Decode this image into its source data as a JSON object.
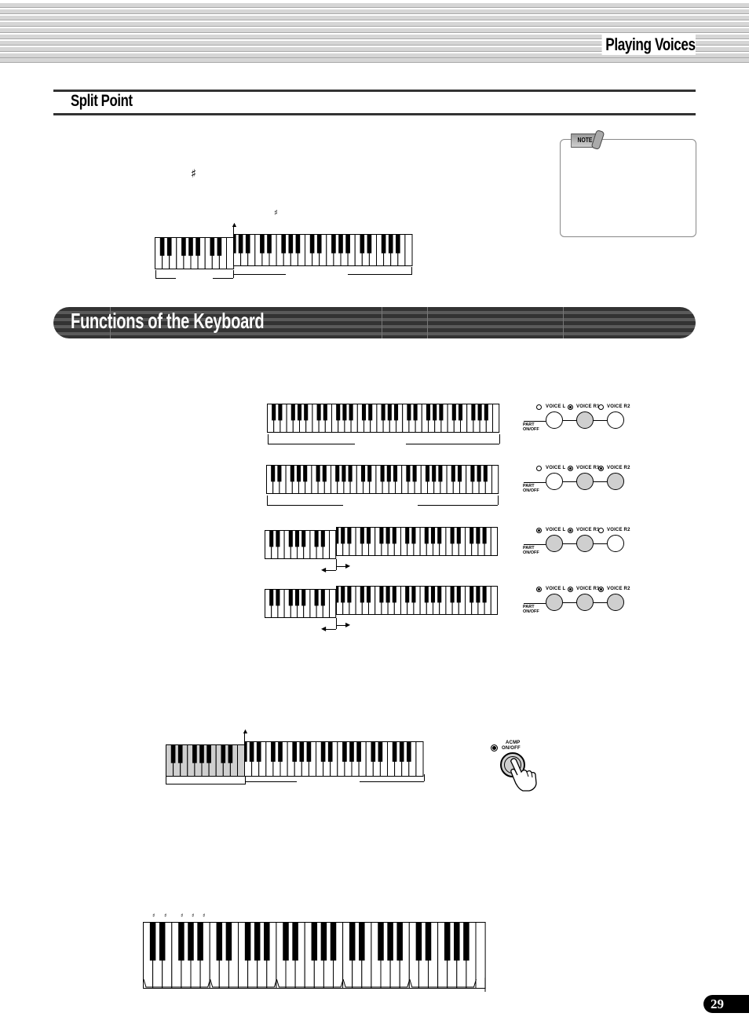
{
  "header": {
    "running_head": "Playing Voices"
  },
  "split_point": {
    "title": "Split Point",
    "sharp_symbol_1": "♯",
    "sharp_symbol_2": "♯",
    "note": {
      "tag": "NOTE"
    }
  },
  "functions_banner": {
    "title": "Functions of the Keyboard"
  },
  "voice_panels": [
    {
      "labels": [
        "VOICE L",
        "VOICE R1",
        "VOICE R2"
      ],
      "lamps": [
        "off",
        "on",
        "off"
      ],
      "buttons": [
        "off",
        "on",
        "off"
      ],
      "part_label": [
        "PART",
        "ON/OFF"
      ]
    },
    {
      "labels": [
        "VOICE L",
        "VOICE R1",
        "VOICE R2"
      ],
      "lamps": [
        "off",
        "on",
        "on"
      ],
      "buttons": [
        "off",
        "on",
        "on"
      ],
      "part_label": [
        "PART",
        "ON/OFF"
      ]
    },
    {
      "labels": [
        "VOICE L",
        "VOICE R1",
        "VOICE R2"
      ],
      "lamps": [
        "on",
        "on",
        "off"
      ],
      "buttons": [
        "on",
        "on",
        "off"
      ],
      "part_label": [
        "PART",
        "ON/OFF"
      ]
    },
    {
      "labels": [
        "VOICE L",
        "VOICE R1",
        "VOICE R2"
      ],
      "lamps": [
        "on",
        "on",
        "on"
      ],
      "buttons": [
        "on",
        "on",
        "on"
      ],
      "part_label": [
        "PART",
        "ON/OFF"
      ]
    }
  ],
  "acmp_button": {
    "label_line1": "ACMP",
    "label_line2": "ON/OFF",
    "lamp": "on"
  },
  "bottom_keyboard": {
    "sharp_marks": [
      "♯",
      "♯",
      "♯",
      "♯",
      "♯"
    ]
  },
  "footer": {
    "page_number": "29"
  }
}
